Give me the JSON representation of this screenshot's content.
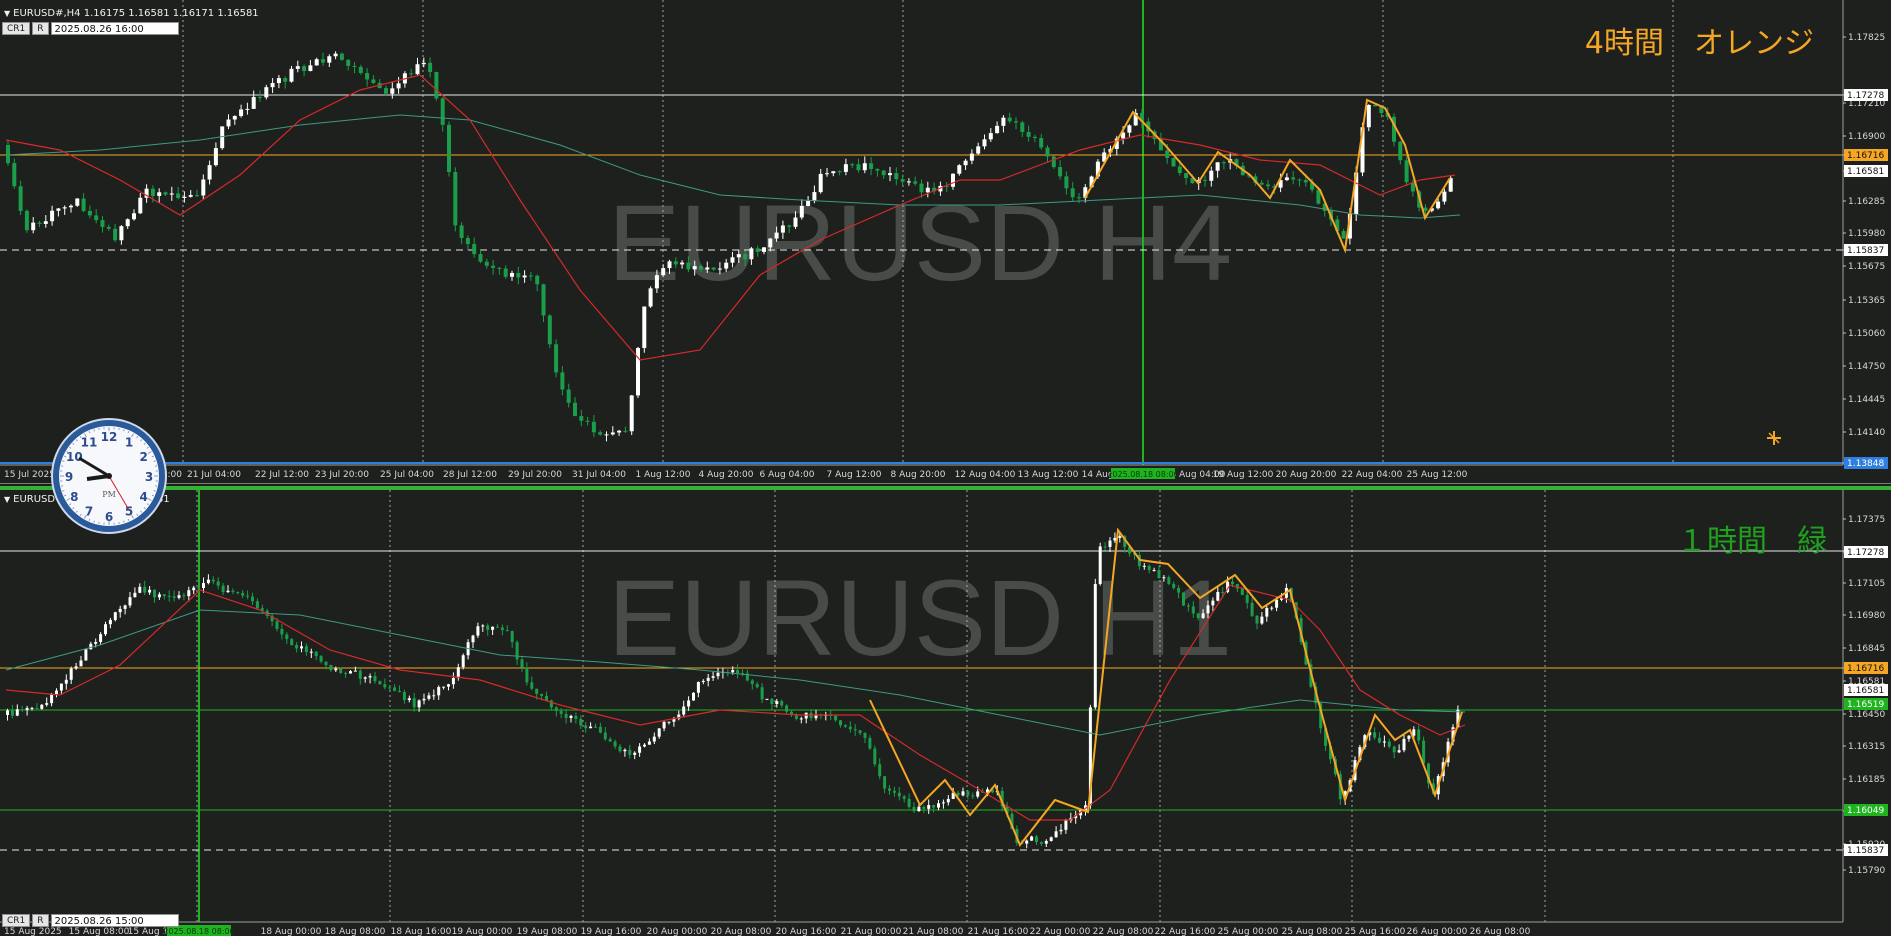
{
  "colors": {
    "background": "#1d201d",
    "grid": "#d0d0d0",
    "bull_candle": "#ffffff",
    "bear_candle": "#1a9e4a",
    "ma_fast": "#d42a2a",
    "ma_slow": "#3d9b82",
    "zigzag": "#f5a623",
    "orange_level": "#f5a623",
    "green_level": "#1fb31f",
    "watermark": "#505450"
  },
  "top_panel": {
    "header_text": "EURUSD#,H4  1.16175 1.16581 1.16171 1.16581",
    "buttons": [
      "CR1",
      "R"
    ],
    "date_value": "2025.08.26 16:00",
    "watermark": "EURUSD H4",
    "corner_label": "4時間　オレンジ",
    "price_ticks": [
      "1.17825",
      "1.17278",
      "1.17210",
      "1.16900",
      "1.16716",
      "1.16581",
      "1.16285",
      "1.15980",
      "1.15837",
      "1.15675",
      "1.15365",
      "1.15060",
      "1.14750",
      "1.14445",
      "1.14140",
      "1.13848"
    ],
    "price_badges": [
      {
        "label": "1.17278",
        "kind": "white"
      },
      {
        "label": "1.16716",
        "kind": "orange"
      },
      {
        "label": "1.16581",
        "kind": "white"
      },
      {
        "label": "1.15837",
        "kind": "white"
      },
      {
        "label": "1.13848",
        "kind": "blue"
      }
    ],
    "time_ticks": [
      "15 Jul 2025",
      "18 Jul 20:00",
      "21 Jul 04:00",
      "22 Jul 12:00",
      "23 Jul 20:00",
      "25 Jul 04:00",
      "28 Jul 12:00",
      "29 Jul 20:00",
      "31 Jul 04:00",
      "1 Aug 12:00",
      "4 Aug 20:00",
      "6 Aug 04:00",
      "7 Aug 12:00",
      "8 Aug 20:00",
      "12 Aug 04:00",
      "13 Aug 12:00",
      "14 Aug 20:00",
      "18 Aug 04:00",
      "19 Aug 12:00",
      "20 Aug 20:00",
      "22 Aug 04:00",
      "25 Aug 12:00"
    ],
    "highlight_time": "2025.08.18 08:00",
    "tool_icon": "crosshair-icon"
  },
  "bottom_panel": {
    "header_text": "EURUSD#,H1  1.16409 1.16581",
    "buttons": [
      "CR1",
      "R"
    ],
    "date_value": "2025.08.26 15:00",
    "watermark": "EURUSD H1",
    "corner_label": "１時間　緑",
    "price_ticks": [
      "1.17375",
      "1.17278",
      "1.17245",
      "1.17105",
      "1.16980",
      "1.16845",
      "1.16716",
      "1.16581",
      "1.16450",
      "1.16315",
      "1.16185",
      "1.16049",
      "1.15920",
      "1.15837",
      "1.15790"
    ],
    "price_badges": [
      {
        "label": "1.17278",
        "kind": "white"
      },
      {
        "label": "1.16716",
        "kind": "orange"
      },
      {
        "label": "1.16581",
        "kind": "white"
      },
      {
        "label": "1.16519",
        "kind": "green"
      },
      {
        "label": "1.16049",
        "kind": "green"
      },
      {
        "label": "1.15837",
        "kind": "white"
      }
    ],
    "time_ticks": [
      "15 Aug 2025",
      "15 Aug 08:00",
      "15 Aug 16:00",
      "18 Aug 00:00",
      "18 Aug 08:00",
      "18 Aug 16:00",
      "19 Aug 00:00",
      "19 Aug 08:00",
      "19 Aug 16:00",
      "20 Aug 00:00",
      "20 Aug 08:00",
      "20 Aug 16:00",
      "21 Aug 00:00",
      "21 Aug 08:00",
      "21 Aug 16:00",
      "22 Aug 00:00",
      "22 Aug 08:00",
      "22 Aug 16:00",
      "25 Aug 00:00",
      "25 Aug 08:00",
      "25 Aug 16:00",
      "26 Aug 00:00",
      "26 Aug 08:00"
    ],
    "highlight_time": "2025.08.18 08:00"
  },
  "clock": {
    "numerals": [
      "12",
      "1",
      "2",
      "3",
      "4",
      "5",
      "6",
      "7",
      "8",
      "9",
      "10",
      "11"
    ],
    "am_pm": "PM"
  }
}
